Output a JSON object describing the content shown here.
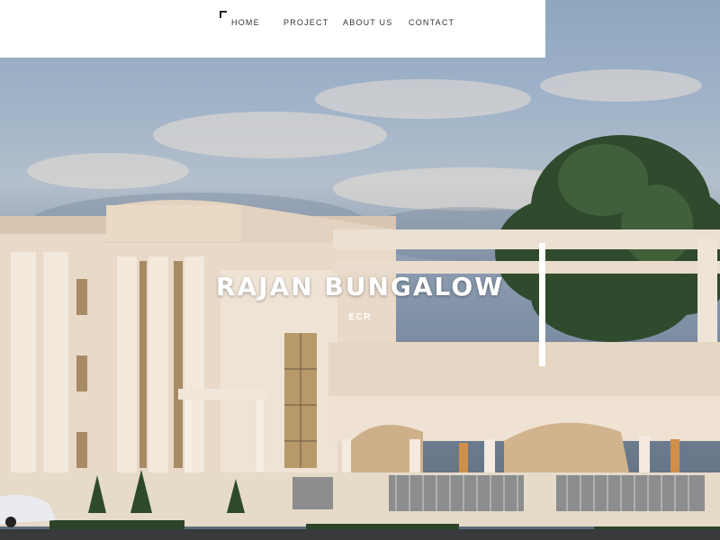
{
  "nav": {
    "items": [
      {
        "label": "HOME"
      },
      {
        "label": "PROJECT"
      },
      {
        "label": "ABOUT US"
      },
      {
        "label": "CONTACT"
      }
    ]
  },
  "hero": {
    "title": "RAJAN BUNGALOW",
    "subtitle": "ECR",
    "image_subject": "bungalow-rendering"
  },
  "colors": {
    "navbar_bg": "#ffffff",
    "text_light": "#ffffff",
    "nav_text": "#333333"
  }
}
